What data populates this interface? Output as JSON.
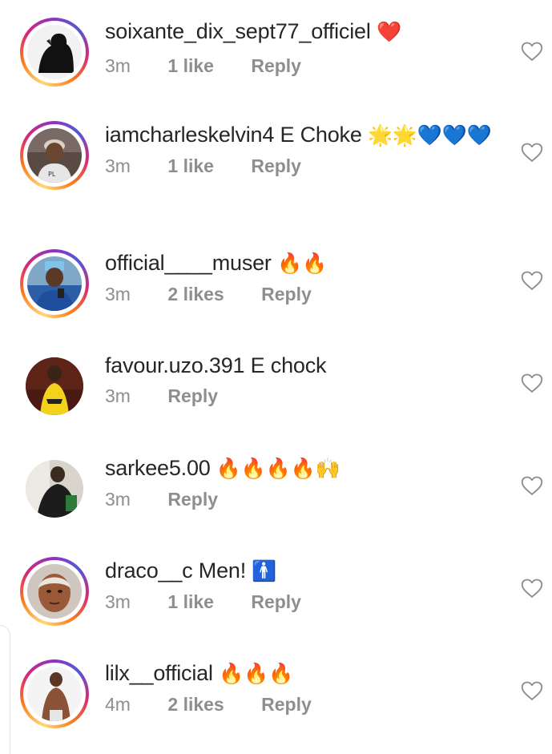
{
  "comments": [
    {
      "username": "soixante_dix_sept77_officiel",
      "text": "",
      "emoji": "❤️",
      "time": "3m",
      "likes": "1 like",
      "reply": "Reply",
      "avatar_icon": "avatar-dark-profile-icon",
      "story_ring": true
    },
    {
      "username": "iamcharleskelvin4",
      "text": "E Choke",
      "emoji": "🌟🌟💙💙💙",
      "time": "3m",
      "likes": "1 like",
      "reply": "Reply",
      "avatar_icon": "avatar-person-cap-icon",
      "story_ring": true
    },
    {
      "username": "official____muser",
      "text": "",
      "emoji": "🔥🔥",
      "time": "3m",
      "likes": "2 likes",
      "reply": "Reply",
      "avatar_icon": "avatar-person-blue-icon",
      "story_ring": true
    },
    {
      "username": "favour.uzo.391",
      "text": "E chock",
      "emoji": "",
      "time": "3m",
      "likes": "",
      "reply": "Reply",
      "avatar_icon": "avatar-person-yellow-dress-icon",
      "story_ring": false
    },
    {
      "username": "sarkee5.00",
      "text": "",
      "emoji": "🔥🔥🔥🔥🙌",
      "time": "3m",
      "likes": "",
      "reply": "Reply",
      "avatar_icon": "avatar-person-dark-icon",
      "story_ring": false
    },
    {
      "username": "draco__c",
      "text": "Men!",
      "emoji": "🚹",
      "time": "3m",
      "likes": "1 like",
      "reply": "Reply",
      "avatar_icon": "avatar-person-selfie-icon",
      "story_ring": true
    },
    {
      "username": "lilx__official",
      "text": "",
      "emoji": "🔥🔥🔥",
      "time": "4m",
      "likes": "2 likes",
      "reply": "Reply",
      "avatar_icon": "avatar-person-shirtless-icon",
      "story_ring": true
    }
  ],
  "colors": {
    "text": "#262626",
    "meta": "#8e8e8e",
    "heart_outline": "#8e8e8e"
  },
  "icons": {
    "like": "heart-outline-icon"
  }
}
